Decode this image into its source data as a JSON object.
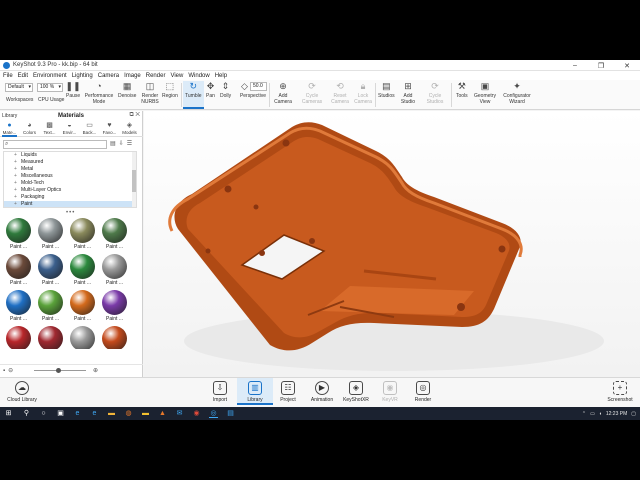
{
  "window": {
    "title": "KeyShot 9.3 Pro  -  kk.bip  -  64 bit"
  },
  "menu": [
    "File",
    "Edit",
    "Environment",
    "Lighting",
    "Camera",
    "Image",
    "Render",
    "View",
    "Window",
    "Help"
  ],
  "ribbon": {
    "workspace_value": "Default",
    "workspace_label": "Workspaces",
    "cpu_value": "100 %",
    "cpu_label": "CPU Usage",
    "pause": "Pause",
    "performance_mode": "Performance Mode",
    "denoise": "Denoise",
    "render_nurbs": "Render NURBS",
    "region": "Region",
    "tumble": "Tumble",
    "pan": "Pan",
    "dolly": "Dolly",
    "fov_value": "50.0",
    "perspective": "Perspective",
    "add_camera": "Add Camera",
    "cycle_cameras": "Cycle Cameras",
    "reset_camera": "Reset Camera",
    "lock_camera": "Lock Camera",
    "studios": "Studios",
    "add_studio": "Add Studio",
    "cycle_studios": "Cycle Studios",
    "tools": "Tools",
    "geometry_view": "Geometry View",
    "configurator_wizard": "Configurator Wizard"
  },
  "library": {
    "panel_label": "Library",
    "title": "Materials",
    "tabs": [
      "Mate...",
      "Colors",
      "Text...",
      "Envir...",
      "Back...",
      "Favo...",
      "Models"
    ],
    "tree": [
      "Liquids",
      "Measured",
      "Metal",
      "Miscellaneous",
      "Mold-Tech",
      "Multi-Layer Optics",
      "Packaging",
      "Paint"
    ],
    "tree_selected": "Paint",
    "materials": [
      {
        "label": "Paint ...",
        "color": "#2f7a3c"
      },
      {
        "label": "Paint ...",
        "color": "#8e9698"
      },
      {
        "label": "Paint ...",
        "color": "#8a8a5c"
      },
      {
        "label": "Paint ...",
        "color": "#4e7a4a"
      },
      {
        "label": "Paint ...",
        "color": "#6b4a3a"
      },
      {
        "label": "Paint ...",
        "color": "#3b5f8c"
      },
      {
        "label": "Paint ...",
        "color": "#2c8a3e"
      },
      {
        "label": "Paint ...",
        "color": "#9a9a9a"
      },
      {
        "label": "Paint ...",
        "color": "#1f6fc4"
      },
      {
        "label": "Paint ...",
        "color": "#5aa23a"
      },
      {
        "label": "Paint ...",
        "color": "#d46a1c"
      },
      {
        "label": "Paint ...",
        "color": "#7a3aa8"
      },
      {
        "label": "",
        "color": "#b8262a"
      },
      {
        "label": "",
        "color": "#a02830"
      },
      {
        "label": "",
        "color": "#9a9a9a"
      },
      {
        "label": "",
        "color": "#c44a1c"
      }
    ]
  },
  "model": {
    "color": "#c85a1e"
  },
  "bottombar": {
    "cloud_library": "Cloud Library",
    "import": "Import",
    "library": "Library",
    "project": "Project",
    "animation": "Animation",
    "keyshotxr": "KeyShotXR",
    "keyvr": "KeyVR",
    "render": "Render",
    "screenshot": "Screenshot"
  },
  "taskbar": {
    "time": "12:23 PM"
  },
  "colors": {
    "accent": "#1a73c9",
    "taskbar": "#1b2230"
  }
}
